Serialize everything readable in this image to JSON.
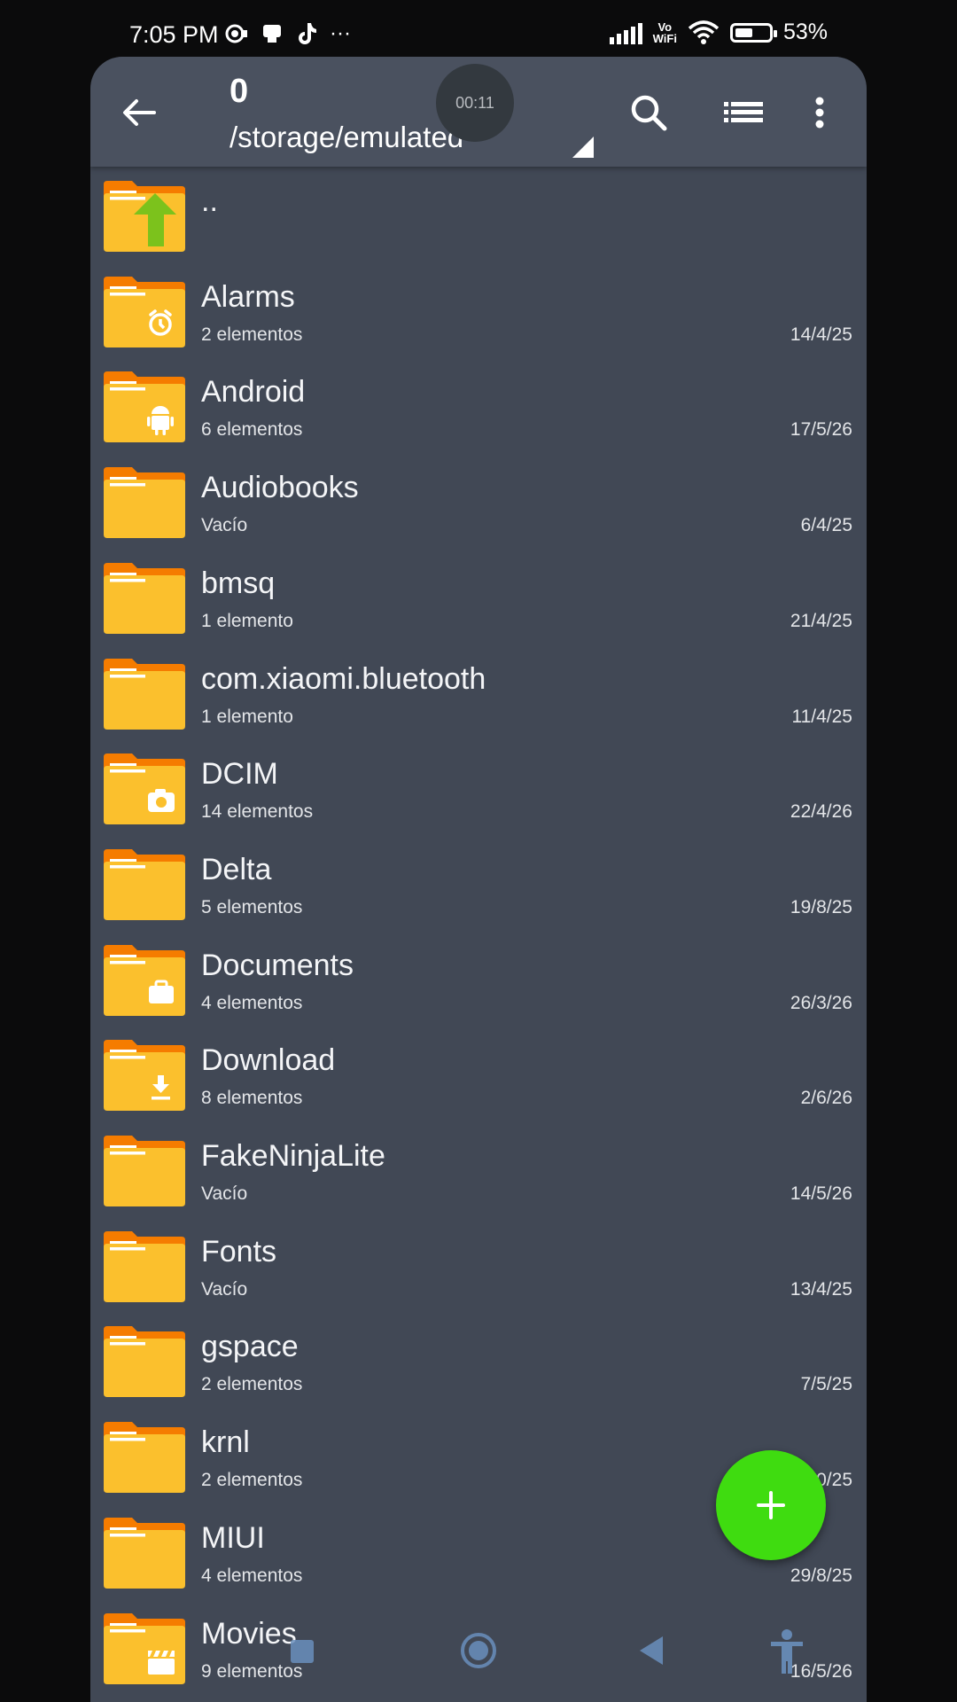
{
  "status_bar": {
    "time": "7:05 PM",
    "vo": "Vo",
    "wifi_label": "WiFi",
    "battery": "53%",
    "battery_level": 0.53,
    "more": "···"
  },
  "toolbar": {
    "count": "0",
    "path": "/storage/emulated",
    "timer": "00:11"
  },
  "folders": [
    {
      "name": "..",
      "meta": "",
      "date": "",
      "emblem": "up"
    },
    {
      "name": "Alarms",
      "meta": "2 elementos",
      "date": "14/4/25",
      "emblem": "alarm"
    },
    {
      "name": "Android",
      "meta": "6 elementos",
      "date": "17/5/26",
      "emblem": "android"
    },
    {
      "name": "Audiobooks",
      "meta": "Vacío",
      "date": "6/4/25",
      "emblem": ""
    },
    {
      "name": "bmsq",
      "meta": "1 elemento",
      "date": "21/4/25",
      "emblem": ""
    },
    {
      "name": "com.xiaomi.bluetooth",
      "meta": "1 elemento",
      "date": "11/4/25",
      "emblem": ""
    },
    {
      "name": "DCIM",
      "meta": "14 elementos",
      "date": "22/4/26",
      "emblem": "camera"
    },
    {
      "name": "Delta",
      "meta": "5 elementos",
      "date": "19/8/25",
      "emblem": ""
    },
    {
      "name": "Documents",
      "meta": "4 elementos",
      "date": "26/3/26",
      "emblem": "briefcase"
    },
    {
      "name": "Download",
      "meta": "8 elementos",
      "date": "2/6/26",
      "emblem": "download"
    },
    {
      "name": "FakeNinjaLite",
      "meta": "Vacío",
      "date": "14/5/26",
      "emblem": ""
    },
    {
      "name": "Fonts",
      "meta": "Vacío",
      "date": "13/4/25",
      "emblem": ""
    },
    {
      "name": "gspace",
      "meta": "2 elementos",
      "date": "7/5/25",
      "emblem": ""
    },
    {
      "name": "krnl",
      "meta": "2 elementos",
      "date": "0/25",
      "emblem": ""
    },
    {
      "name": "MIUI",
      "meta": "4 elementos",
      "date": "29/8/25",
      "emblem": ""
    },
    {
      "name": "Movies",
      "meta": "9 elementos",
      "date": "16/5/26",
      "emblem": "clapper"
    }
  ],
  "colors": {
    "background": "#0b0b0c",
    "panel": "#414855",
    "toolbar": "#4a515f",
    "folder_front": "#fbc02d",
    "folder_tab": "#f57c00",
    "fab": "#3fdc10",
    "up_arrow": "#7cc21c"
  },
  "icons": {
    "back": "arrow-left-icon",
    "search": "search-icon",
    "list_view": "list-view-icon",
    "more": "more-vert-icon",
    "fab": "plus-icon"
  }
}
